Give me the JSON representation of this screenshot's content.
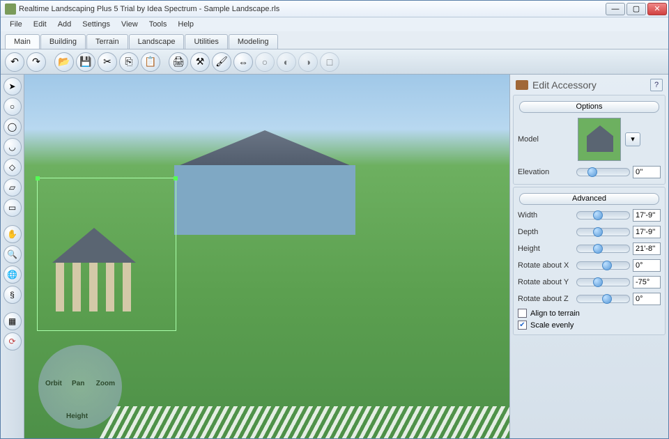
{
  "window": {
    "title": "Realtime Landscaping Plus 5 Trial by Idea Spectrum - Sample Landscape.rls"
  },
  "menu": [
    "File",
    "Edit",
    "Add",
    "Settings",
    "View",
    "Tools",
    "Help"
  ],
  "tabs": [
    "Main",
    "Building",
    "Terrain",
    "Landscape",
    "Utilities",
    "Modeling"
  ],
  "active_tab": 0,
  "nav": {
    "orbit": "Orbit",
    "zoom": "Zoom",
    "pan": "Pan",
    "height": "Height"
  },
  "panel": {
    "title": "Edit Accessory",
    "help": "?",
    "options_label": "Options",
    "advanced_label": "Advanced",
    "model_label": "Model",
    "elevation": {
      "label": "Elevation",
      "value": "0''",
      "pos": 20
    },
    "width": {
      "label": "Width",
      "value": "17'-9''",
      "pos": 30
    },
    "depth": {
      "label": "Depth",
      "value": "17'-9''",
      "pos": 30
    },
    "height": {
      "label": "Height",
      "value": "21'-8''",
      "pos": 30
    },
    "rotx": {
      "label": "Rotate about X",
      "value": "0°",
      "pos": 48
    },
    "roty": {
      "label": "Rotate about Y",
      "value": "-75°",
      "pos": 30
    },
    "rotz": {
      "label": "Rotate about Z",
      "value": "0°",
      "pos": 48
    },
    "align_terrain": {
      "label": "Align to terrain",
      "checked": false
    },
    "scale_evenly": {
      "label": "Scale evenly",
      "checked": true
    }
  }
}
